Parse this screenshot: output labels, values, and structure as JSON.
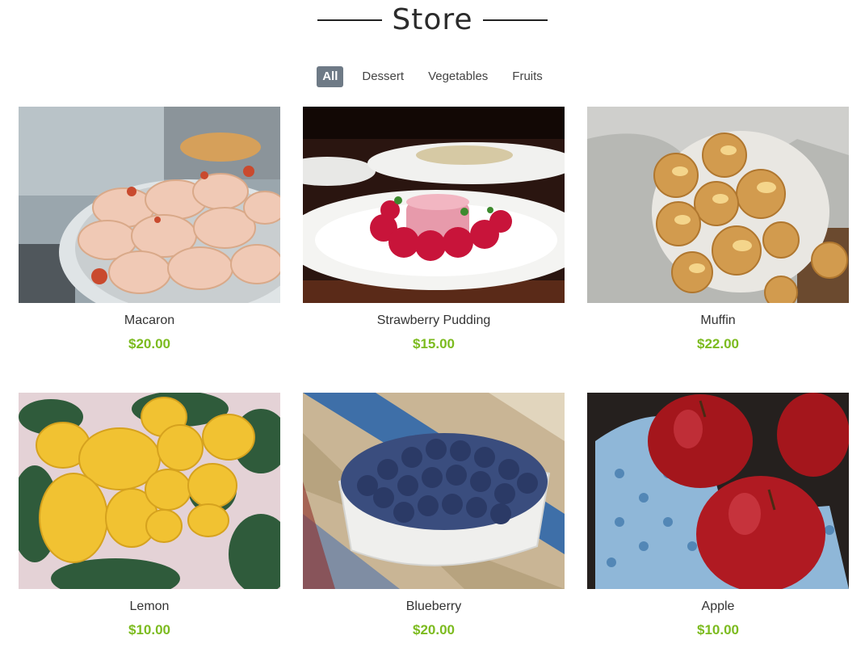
{
  "header": {
    "title": "Store"
  },
  "filters": [
    {
      "label": "All",
      "active": true
    },
    {
      "label": "Dessert",
      "active": false
    },
    {
      "label": "Vegetables",
      "active": false
    },
    {
      "label": "Fruits",
      "active": false
    }
  ],
  "products": [
    {
      "name": "Macaron",
      "price": "$20.00",
      "image": "macaron-photo"
    },
    {
      "name": "Strawberry Pudding",
      "price": "$15.00",
      "image": "strawberry-pudding-photo"
    },
    {
      "name": "Muffin",
      "price": "$22.00",
      "image": "muffin-photo"
    },
    {
      "name": "Lemon",
      "price": "$10.00",
      "image": "lemon-photo"
    },
    {
      "name": "Blueberry",
      "price": "$20.00",
      "image": "blueberry-photo"
    },
    {
      "name": "Apple",
      "price": "$10.00",
      "image": "apple-photo"
    }
  ],
  "colors": {
    "price": "#7cbb1f",
    "active_filter_bg": "#6e7a86"
  }
}
